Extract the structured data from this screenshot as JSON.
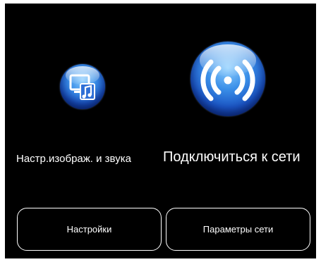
{
  "home_menu": {
    "tiles": [
      {
        "label": "Настр.изображ. и звука",
        "icon": "picture-sound-settings-icon"
      },
      {
        "label": "Подключиться к сети",
        "icon": "network-connect-icon"
      }
    ],
    "buttons": {
      "settings_label": "Настройки",
      "network_settings_label": "Параметры сети"
    }
  },
  "colors": {
    "background": "#000000",
    "text": "#ffffff",
    "orb_light": "#8fd0ff",
    "orb_mid": "#3a8fe8",
    "orb_dark": "#0d2d82"
  }
}
